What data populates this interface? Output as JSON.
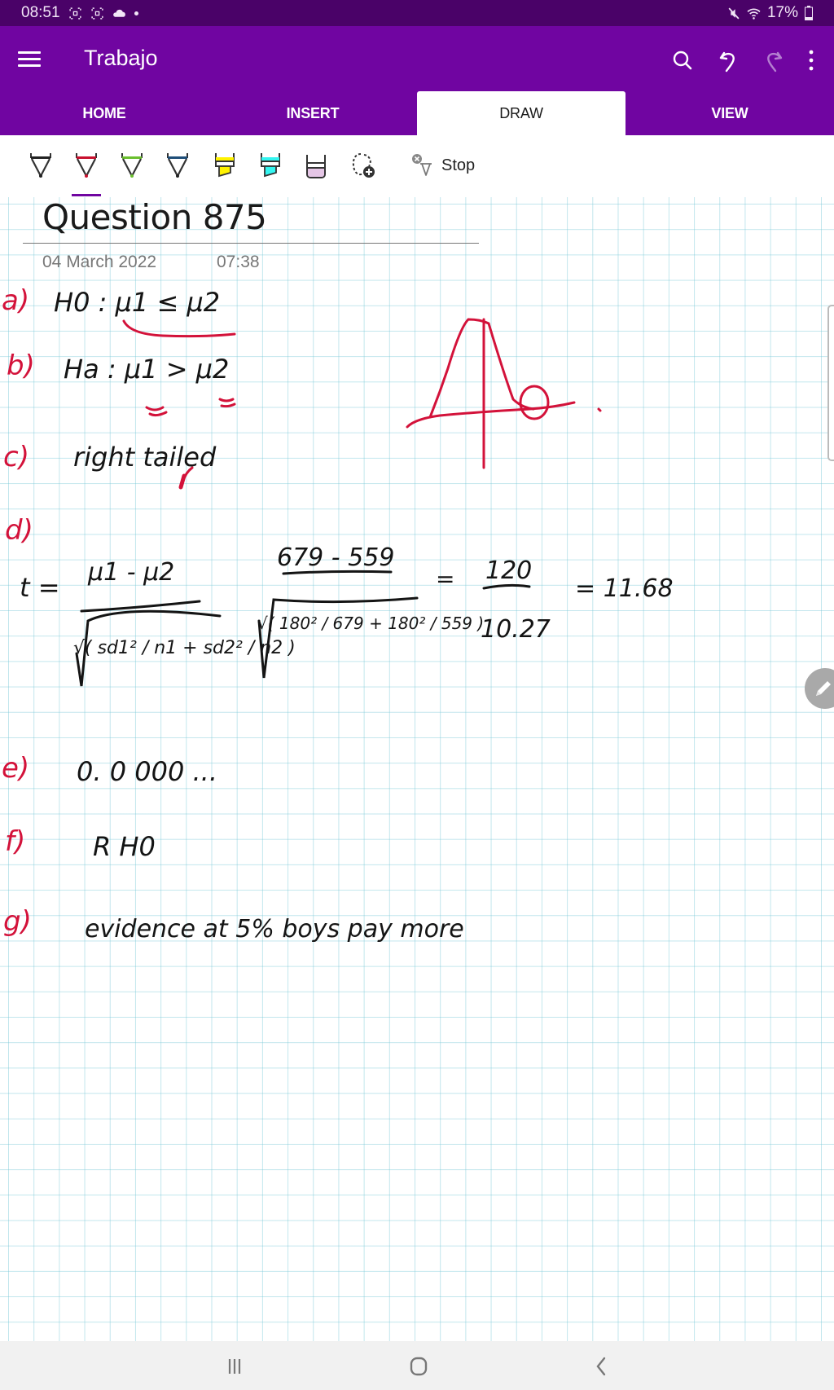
{
  "status_bar": {
    "time": "08:51",
    "left_icons": [
      "screenshot-icon",
      "screenshot-icon",
      "cloud-icon",
      "dot-icon"
    ],
    "right_icons": [
      "mute-icon",
      "wifi-icon",
      "battery-icon"
    ],
    "battery": "17%"
  },
  "app_bar": {
    "title": "Trabajo",
    "actions": [
      "search",
      "undo",
      "redo",
      "more-options"
    ]
  },
  "tabs": [
    {
      "label": "HOME",
      "active": false
    },
    {
      "label": "INSERT",
      "active": false
    },
    {
      "label": "DRAW",
      "active": true
    },
    {
      "label": "VIEW",
      "active": false
    }
  ],
  "ribbon": {
    "pens": [
      {
        "name": "pen-black",
        "color": "#222222"
      },
      {
        "name": "pen-red",
        "color": "#c8102e",
        "selected": true
      },
      {
        "name": "pen-green",
        "color": "#6abf2e"
      },
      {
        "name": "pen-blue",
        "color": "#1f4e79"
      },
      {
        "name": "highlighter-yellow",
        "color": "#fff200"
      },
      {
        "name": "highlighter-cyan",
        "color": "#33f5f0"
      },
      {
        "name": "highlighter-lavender",
        "color": "#e5c6e6"
      },
      {
        "name": "lasso-add",
        "color": "#333333"
      }
    ],
    "stop_label": "Stop"
  },
  "page": {
    "title": "Question 875",
    "date": "04 March 2022",
    "time": "07:38"
  },
  "ink": {
    "ink_color_black": "#141414",
    "ink_color_red": "#d3123a",
    "labels": [
      "a)",
      "b)",
      "c)",
      "d)",
      "e)",
      "f)",
      "g)"
    ],
    "a": "H0 : μ1 ≤ μ2",
    "b": "Ha : μ1 > μ2",
    "c": "right tailed",
    "d_lhs": "t =",
    "d_num1": "μ1 - μ2",
    "d_den1": "√( sd1² / n1 + sd2² / n2 )",
    "d_num2": "679 - 559",
    "d_den2": "√( 180² / 679 + 180² / 559 )",
    "d_num3": "120",
    "d_den3": "10.27",
    "d_result": "11.68",
    "e": "0. 0 000 ...",
    "f": "R H0",
    "g": "evidence at 5%  boys pay more"
  },
  "nav_bar": {
    "buttons": [
      "recent-apps",
      "home",
      "back"
    ]
  }
}
